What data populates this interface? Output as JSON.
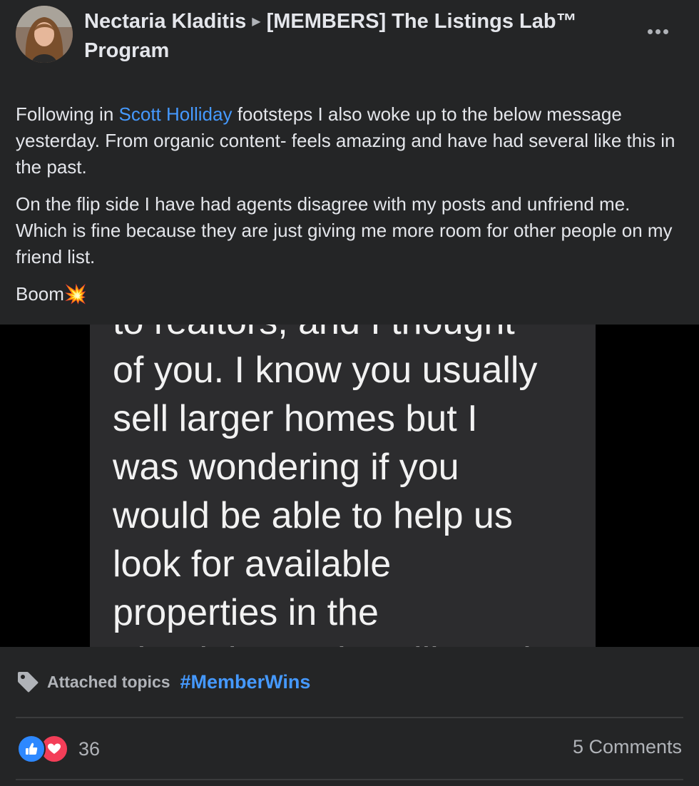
{
  "post": {
    "author": "Nectaria Kladitis",
    "group": "[MEMBERS] The Listings Lab™ Program",
    "paragraphs": {
      "p1_before": "Following in ",
      "p1_mention": "Scott Holliday",
      "p1_after": " footsteps I also woke up to the below message yesterday. From organic content- feels amazing and have had several like this in the past.",
      "p2": "On the flip side I have had agents disagree with my posts and unfriend me. Which is fine because they are just giving me more room for other people on my friend list.",
      "p3": "Boom💥"
    },
    "image_text": [
      "to realtors, and I thought",
      "of you. I know you usually",
      "sell larger homes but I",
      "was wondering if you",
      "would be able to help us",
      "look for available",
      "properties in the",
      "Pinedale, Jenks, ville and"
    ],
    "topics": {
      "label": "Attached topics",
      "tag": "#MemberWins"
    },
    "reactions": {
      "count": "36",
      "types": [
        "like-icon",
        "love-icon"
      ]
    },
    "comments": "5 Comments",
    "colors": {
      "background": "#242526",
      "link": "#4599ff",
      "like": "#2d88ff",
      "love": "#f33e58"
    }
  }
}
